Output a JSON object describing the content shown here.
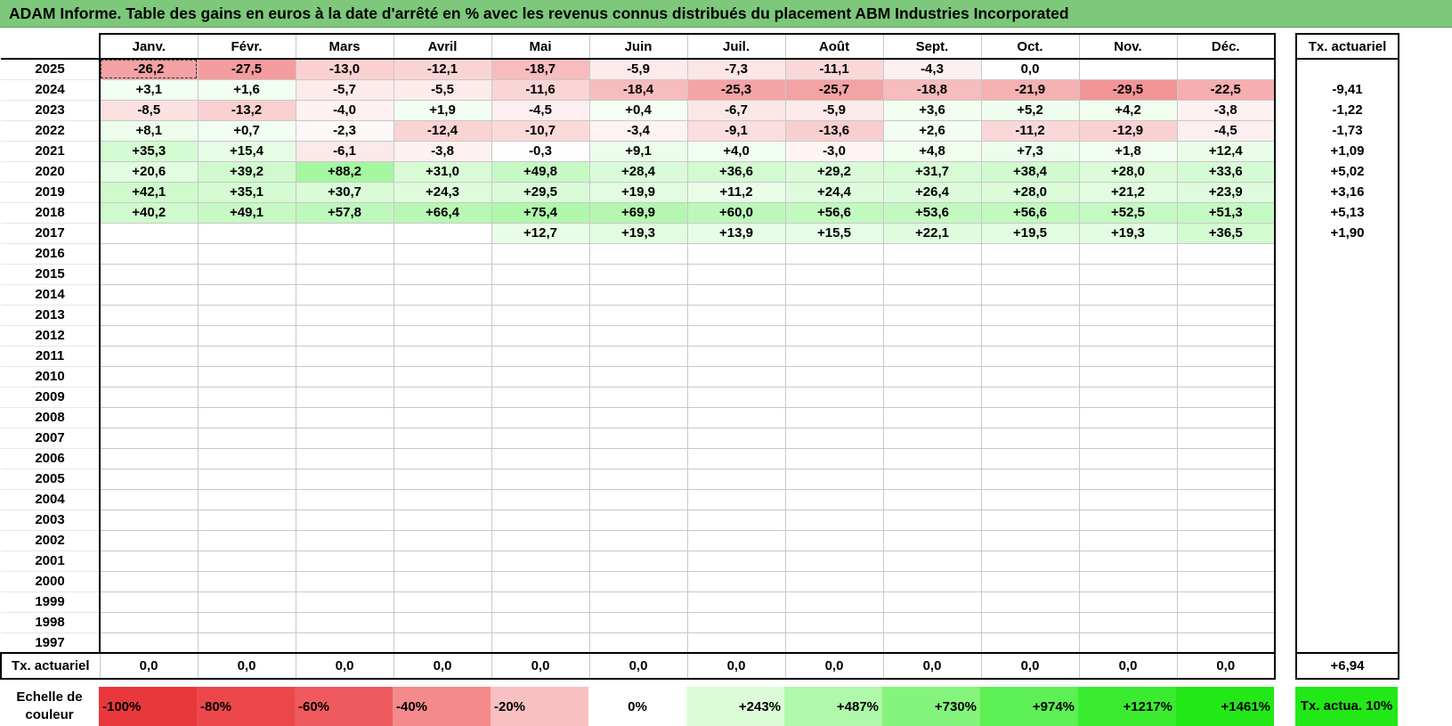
{
  "title": "ADAM Informe. Table des gains en euros à la date d'arrêté en % avec les revenus connus distribués du placement ABM Industries Incorporated",
  "months": [
    "Janv.",
    "Févr.",
    "Mars",
    "Avril",
    "Mai",
    "Juin",
    "Juil.",
    "Août",
    "Sept.",
    "Oct.",
    "Nov.",
    "Déc."
  ],
  "actuarial_header": "Tx. actuariel",
  "rows": [
    {
      "year": "2025",
      "cells": [
        "-26,2",
        "-27,5",
        "-13,0",
        "-12,1",
        "-18,7",
        "-5,9",
        "-7,3",
        "-11,1",
        "-4,3",
        "0,0",
        "",
        ""
      ],
      "rate": ""
    },
    {
      "year": "2024",
      "cells": [
        "+3,1",
        "+1,6",
        "-5,7",
        "-5,5",
        "-11,6",
        "-18,4",
        "-25,3",
        "-25,7",
        "-18,8",
        "-21,9",
        "-29,5",
        "-22,5"
      ],
      "rate": "-9,41"
    },
    {
      "year": "2023",
      "cells": [
        "-8,5",
        "-13,2",
        "-4,0",
        "+1,9",
        "-4,5",
        "+0,4",
        "-6,7",
        "-5,9",
        "+3,6",
        "+5,2",
        "+4,2",
        "-3,8"
      ],
      "rate": "-1,22"
    },
    {
      "year": "2022",
      "cells": [
        "+8,1",
        "+0,7",
        "-2,3",
        "-12,4",
        "-10,7",
        "-3,4",
        "-9,1",
        "-13,6",
        "+2,6",
        "-11,2",
        "-12,9",
        "-4,5"
      ],
      "rate": "-1,73"
    },
    {
      "year": "2021",
      "cells": [
        "+35,3",
        "+15,4",
        "-6,1",
        "-3,8",
        "-0,3",
        "+9,1",
        "+4,0",
        "-3,0",
        "+4,8",
        "+7,3",
        "+1,8",
        "+12,4"
      ],
      "rate": "+1,09"
    },
    {
      "year": "2020",
      "cells": [
        "+20,6",
        "+39,2",
        "+88,2",
        "+31,0",
        "+49,8",
        "+28,4",
        "+36,6",
        "+29,2",
        "+31,7",
        "+38,4",
        "+28,0",
        "+33,6"
      ],
      "rate": "+5,02"
    },
    {
      "year": "2019",
      "cells": [
        "+42,1",
        "+35,1",
        "+30,7",
        "+24,3",
        "+29,5",
        "+19,9",
        "+11,2",
        "+24,4",
        "+26,4",
        "+28,0",
        "+21,2",
        "+23,9"
      ],
      "rate": "+3,16"
    },
    {
      "year": "2018",
      "cells": [
        "+40,2",
        "+49,1",
        "+57,8",
        "+66,4",
        "+75,4",
        "+69,9",
        "+60,0",
        "+56,6",
        "+53,6",
        "+56,6",
        "+52,5",
        "+51,3"
      ],
      "rate": "+5,13"
    },
    {
      "year": "2017",
      "cells": [
        "",
        "",
        "",
        "",
        "+12,7",
        "+19,3",
        "+13,9",
        "+15,5",
        "+22,1",
        "+19,5",
        "+19,3",
        "+36,5"
      ],
      "rate": "+1,90"
    },
    {
      "year": "2016",
      "cells": [
        "",
        "",
        "",
        "",
        "",
        "",
        "",
        "",
        "",
        "",
        "",
        ""
      ],
      "rate": ""
    },
    {
      "year": "2015",
      "cells": [
        "",
        "",
        "",
        "",
        "",
        "",
        "",
        "",
        "",
        "",
        "",
        ""
      ],
      "rate": ""
    },
    {
      "year": "2014",
      "cells": [
        "",
        "",
        "",
        "",
        "",
        "",
        "",
        "",
        "",
        "",
        "",
        ""
      ],
      "rate": ""
    },
    {
      "year": "2013",
      "cells": [
        "",
        "",
        "",
        "",
        "",
        "",
        "",
        "",
        "",
        "",
        "",
        ""
      ],
      "rate": ""
    },
    {
      "year": "2012",
      "cells": [
        "",
        "",
        "",
        "",
        "",
        "",
        "",
        "",
        "",
        "",
        "",
        ""
      ],
      "rate": ""
    },
    {
      "year": "2011",
      "cells": [
        "",
        "",
        "",
        "",
        "",
        "",
        "",
        "",
        "",
        "",
        "",
        ""
      ],
      "rate": ""
    },
    {
      "year": "2010",
      "cells": [
        "",
        "",
        "",
        "",
        "",
        "",
        "",
        "",
        "",
        "",
        "",
        ""
      ],
      "rate": ""
    },
    {
      "year": "2009",
      "cells": [
        "",
        "",
        "",
        "",
        "",
        "",
        "",
        "",
        "",
        "",
        "",
        ""
      ],
      "rate": ""
    },
    {
      "year": "2008",
      "cells": [
        "",
        "",
        "",
        "",
        "",
        "",
        "",
        "",
        "",
        "",
        "",
        ""
      ],
      "rate": ""
    },
    {
      "year": "2007",
      "cells": [
        "",
        "",
        "",
        "",
        "",
        "",
        "",
        "",
        "",
        "",
        "",
        ""
      ],
      "rate": ""
    },
    {
      "year": "2006",
      "cells": [
        "",
        "",
        "",
        "",
        "",
        "",
        "",
        "",
        "",
        "",
        "",
        ""
      ],
      "rate": ""
    },
    {
      "year": "2005",
      "cells": [
        "",
        "",
        "",
        "",
        "",
        "",
        "",
        "",
        "",
        "",
        "",
        ""
      ],
      "rate": ""
    },
    {
      "year": "2004",
      "cells": [
        "",
        "",
        "",
        "",
        "",
        "",
        "",
        "",
        "",
        "",
        "",
        ""
      ],
      "rate": ""
    },
    {
      "year": "2003",
      "cells": [
        "",
        "",
        "",
        "",
        "",
        "",
        "",
        "",
        "",
        "",
        "",
        ""
      ],
      "rate": ""
    },
    {
      "year": "2002",
      "cells": [
        "",
        "",
        "",
        "",
        "",
        "",
        "",
        "",
        "",
        "",
        "",
        ""
      ],
      "rate": ""
    },
    {
      "year": "2001",
      "cells": [
        "",
        "",
        "",
        "",
        "",
        "",
        "",
        "",
        "",
        "",
        "",
        ""
      ],
      "rate": ""
    },
    {
      "year": "2000",
      "cells": [
        "",
        "",
        "",
        "",
        "",
        "",
        "",
        "",
        "",
        "",
        "",
        ""
      ],
      "rate": ""
    },
    {
      "year": "1999",
      "cells": [
        "",
        "",
        "",
        "",
        "",
        "",
        "",
        "",
        "",
        "",
        "",
        ""
      ],
      "rate": ""
    },
    {
      "year": "1998",
      "cells": [
        "",
        "",
        "",
        "",
        "",
        "",
        "",
        "",
        "",
        "",
        "",
        ""
      ],
      "rate": ""
    },
    {
      "year": "1997",
      "cells": [
        "",
        "",
        "",
        "",
        "",
        "",
        "",
        "",
        "",
        "",
        "",
        ""
      ],
      "rate": ""
    }
  ],
  "total_row": {
    "label": "Tx. actuariel",
    "cells": [
      "0,0",
      "0,0",
      "0,0",
      "0,0",
      "0,0",
      "0,0",
      "0,0",
      "0,0",
      "0,0",
      "0,0",
      "0,0",
      "0,0"
    ],
    "rate": "+6,94"
  },
  "legend": {
    "title": "Echelle de couleur",
    "items": [
      {
        "label": "-100%",
        "color": "#e8383c"
      },
      {
        "label": "-80%",
        "color": "#ec484c"
      },
      {
        "label": "-60%",
        "color": "#ef5a5e"
      },
      {
        "label": "-40%",
        "color": "#f48a8c"
      },
      {
        "label": "-20%",
        "color": "#f9c0c1"
      },
      {
        "label": "0%",
        "color": "#ffffff"
      },
      {
        "label": "+243%",
        "color": "#dcfcd8"
      },
      {
        "label": "+487%",
        "color": "#b0f8aa"
      },
      {
        "label": "+730%",
        "color": "#84f47c"
      },
      {
        "label": "+974%",
        "color": "#5cf054"
      },
      {
        "label": "+1217%",
        "color": "#3aec30"
      },
      {
        "label": "+1461%",
        "color": "#22e818"
      }
    ],
    "actuarial_label": "Tx. actua. 10%",
    "actuarial_color": "#22e818"
  },
  "colors": {
    "title_bar": "#7dc87a",
    "negative_scale": [
      "#ffffff",
      "#e8383c"
    ],
    "positive_scale": [
      "#ffffff",
      "#22e818"
    ]
  }
}
